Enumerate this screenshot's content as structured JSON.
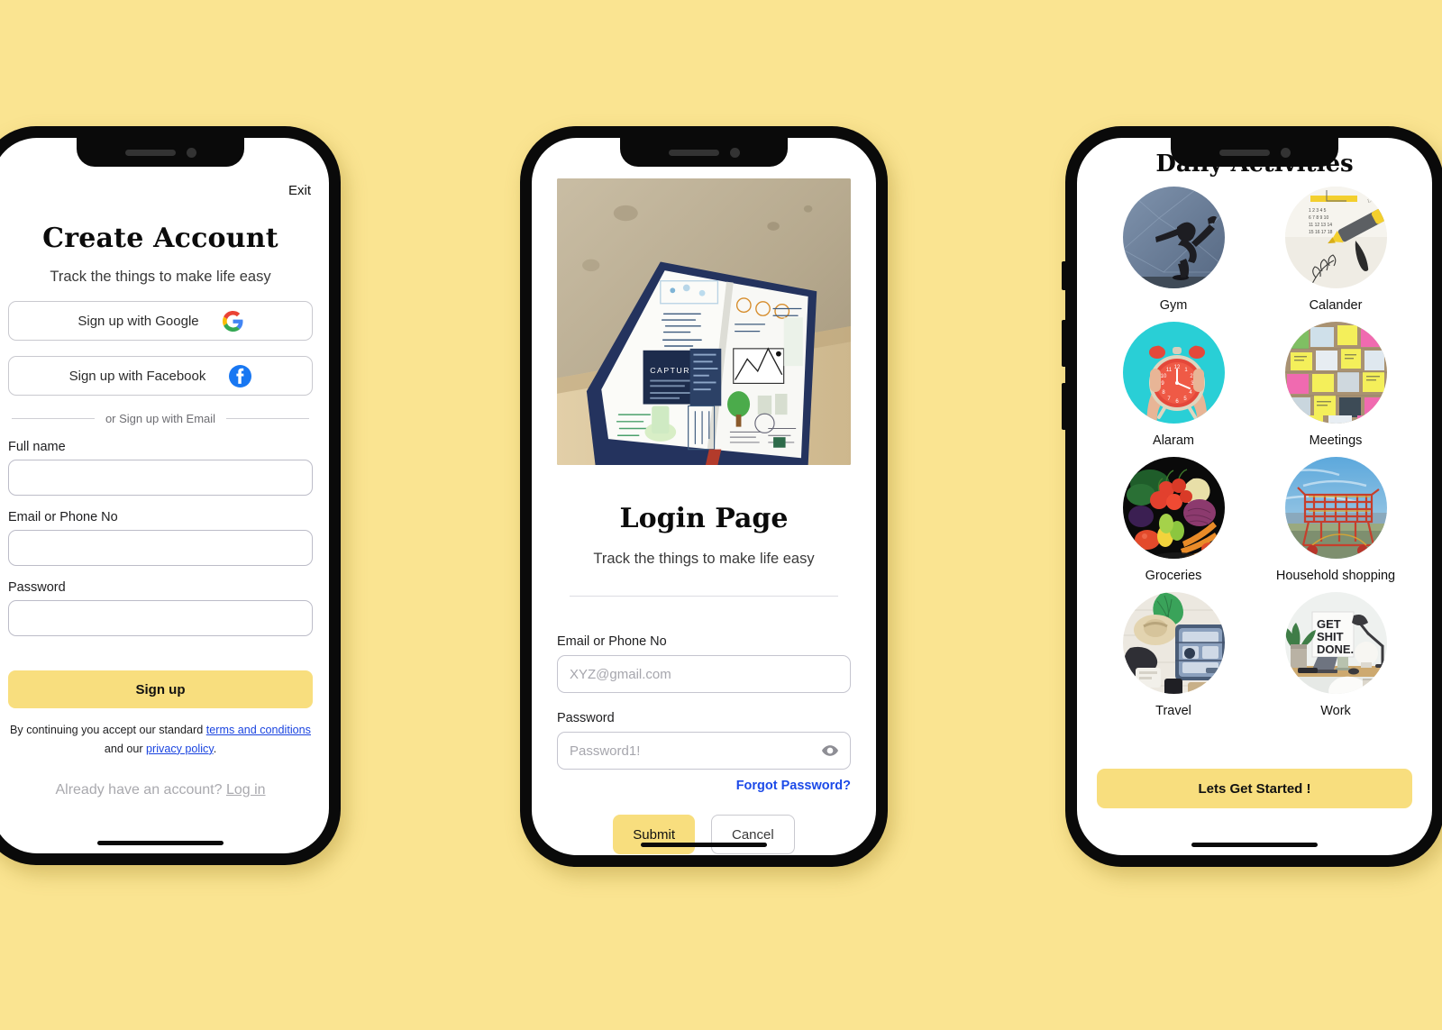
{
  "background_color": "#FAE491",
  "accent_color": "#F8DE7E",
  "link_color": "#1A44E0",
  "screens": {
    "signup": {
      "exit_label": "Exit",
      "title": "Create Account",
      "subtitle": "Track the things to make life easy",
      "google_button": "Sign up with Google",
      "google_icon": "google-icon",
      "facebook_button": "Sign up with Facebook",
      "facebook_icon": "facebook-icon",
      "divider_text": "or Sign up with Email",
      "fields": [
        {
          "label": "Full name",
          "value": "",
          "placeholder": ""
        },
        {
          "label": "Email or Phone No",
          "value": "",
          "placeholder": ""
        },
        {
          "label": "Password",
          "value": "",
          "placeholder": ""
        }
      ],
      "submit_label": "Sign up",
      "legal_line1_prefix": "By continuing you accept our standard ",
      "legal_terms_link": "terms and conditions",
      "legal_line2_prefix": "and our ",
      "legal_privacy_link": "privacy policy",
      "legal_line2_suffix": ".",
      "already_text": "Already have an account? ",
      "login_link": "Log in"
    },
    "login": {
      "hero_image_alt": "open bullet-journal notebook on wooden table",
      "title": "Login  Page",
      "subtitle": "Track the things to make life easy",
      "email_label": "Email or Phone No",
      "email_placeholder": "XYZ@gmail.com",
      "email_value": "",
      "password_label": "Password",
      "password_placeholder": "Password1!",
      "password_value": "",
      "show_password_icon": "eye-icon",
      "forgot_label": "Forgot Password?",
      "submit_label": "Submit",
      "cancel_label": "Cancel"
    },
    "categories": {
      "title": "Daily Activities",
      "items": [
        {
          "label": "Gym",
          "image_alt": "woman doing yoga dancer pose"
        },
        {
          "label": "Calander",
          "image_alt": "calendar page with yellow highlighter"
        },
        {
          "label": "Alaram",
          "image_alt": "hands holding red alarm clock on teal background"
        },
        {
          "label": "Meetings",
          "image_alt": "cork board covered in sticky notes and photos"
        },
        {
          "label": "Groceries",
          "image_alt": "assorted fresh vegetables on black background"
        },
        {
          "label": "Household shopping",
          "image_alt": "red shopping cart by the sea"
        },
        {
          "label": "Travel",
          "image_alt": "packed suitcase with sun hat flat lay"
        },
        {
          "label": "Work",
          "image_alt": "desk with GET SHIT DONE poster and lamp"
        }
      ],
      "cta_label": "Lets Get Started !"
    }
  }
}
